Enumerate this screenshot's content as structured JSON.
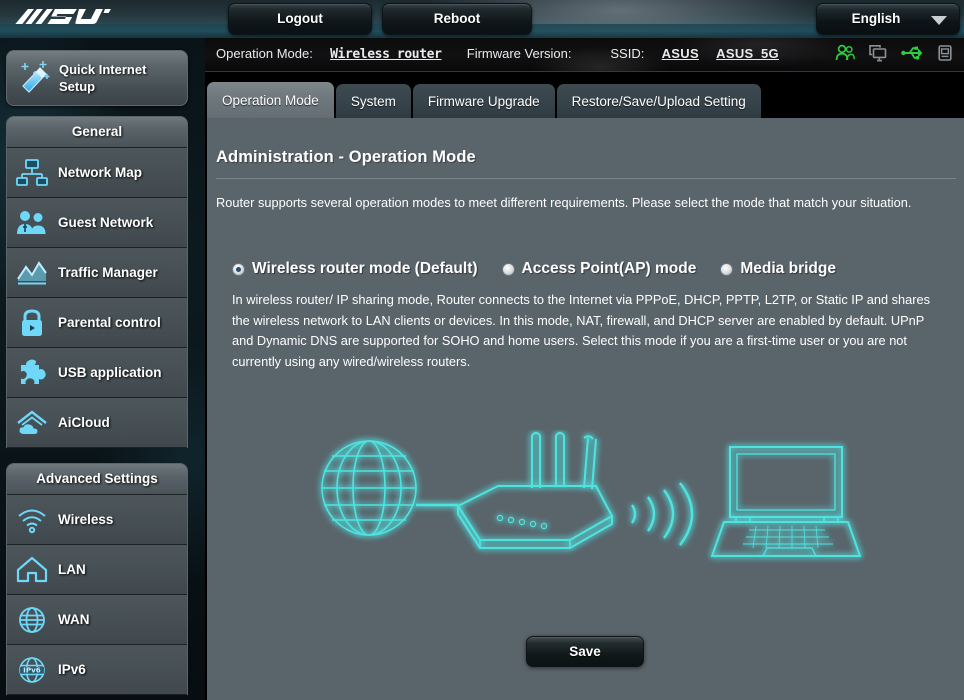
{
  "brand": {
    "logo_text": "/ISUS"
  },
  "topbar": {
    "logout_label": "Logout",
    "reboot_label": "Reboot",
    "language": "English",
    "caret_icon": "chevron-down-icon"
  },
  "statusbar": {
    "operation_mode_label": "Operation Mode:",
    "operation_mode_value": "Wireless router",
    "firmware_label": "Firmware Version:",
    "firmware_value": "",
    "ssid_label": "SSID:",
    "ssid_1": "ASUS",
    "ssid_2": "ASUS_5G",
    "icons": [
      {
        "name": "clients-users-icon",
        "color": "#2ecc3f"
      },
      {
        "name": "monitors-icon",
        "color": "#8b9196"
      },
      {
        "name": "usb-icon",
        "color": "#2ecc3f"
      },
      {
        "name": "printer-icon",
        "color": "#8b9196"
      }
    ]
  },
  "sidebar": {
    "quick_setup": {
      "label": "Quick Internet Setup",
      "icon": "magic-wand-icon"
    },
    "groups": [
      {
        "header": "General",
        "items": [
          {
            "label": "Network Map",
            "icon": "network-map-icon"
          },
          {
            "label": "Guest Network",
            "icon": "guest-network-icon"
          },
          {
            "label": "Traffic Manager",
            "icon": "traffic-manager-icon"
          },
          {
            "label": "Parental control",
            "icon": "lock-icon"
          },
          {
            "label": "USB application",
            "icon": "puzzle-piece-icon"
          },
          {
            "label": "AiCloud",
            "icon": "aicloud-icon"
          }
        ]
      },
      {
        "header": "Advanced Settings",
        "items": [
          {
            "label": "Wireless",
            "icon": "wifi-icon"
          },
          {
            "label": "LAN",
            "icon": "house-icon"
          },
          {
            "label": "WAN",
            "icon": "globe-icon"
          },
          {
            "label": "IPv6",
            "icon": "ipv6-globe-icon"
          }
        ]
      }
    ]
  },
  "tabs": [
    {
      "label": "Operation Mode",
      "active": true
    },
    {
      "label": "System",
      "active": false
    },
    {
      "label": "Firmware Upgrade",
      "active": false
    },
    {
      "label": "Restore/Save/Upload Setting",
      "active": false
    }
  ],
  "main": {
    "title": "Administration - Operation Mode",
    "intro": "Router supports several operation modes to meet different requirements. Please select the mode that match your situation.",
    "modes": [
      {
        "label": "Wireless router mode (Default)",
        "selected": true
      },
      {
        "label": "Access Point(AP) mode",
        "selected": false
      },
      {
        "label": "Media bridge",
        "selected": false
      }
    ],
    "mode_description": "In wireless router/ IP sharing mode, Router connects to the Internet via PPPoE, DHCP, PPTP, L2TP, or Static IP and shares the wireless network to LAN clients or devices. In this mode, NAT, firewall, and DHCP server are enabled by default. UPnP and Dynamic DNS are supported for SOHO and home users. Select this mode if you are a first-time user or you are not currently using any wired/wireless routers.",
    "diagram": {
      "nodes": [
        "globe-internet-icon",
        "wireless-router-icon",
        "wifi-waves-icon",
        "laptop-icon"
      ],
      "glow_color": "#4fe3e0"
    },
    "save_label": "Save"
  }
}
